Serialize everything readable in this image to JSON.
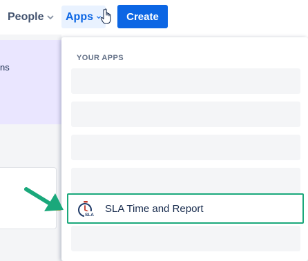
{
  "nav": {
    "people_label": "People",
    "apps_label": "Apps",
    "create_label": "Create"
  },
  "background": {
    "banner_fragment": "ns"
  },
  "dropdown": {
    "section_title": "YOUR APPS",
    "apps": [
      {
        "label": "SLA Time and Report",
        "icon": "stopwatch-icon",
        "icon_text": "SLA"
      }
    ]
  },
  "colors": {
    "primary": "#0c66e4",
    "highlight_border": "#1aa87b",
    "arrow": "#1aa87b",
    "banner": "#eae6ff",
    "accent_yellow": "#f5a623"
  }
}
